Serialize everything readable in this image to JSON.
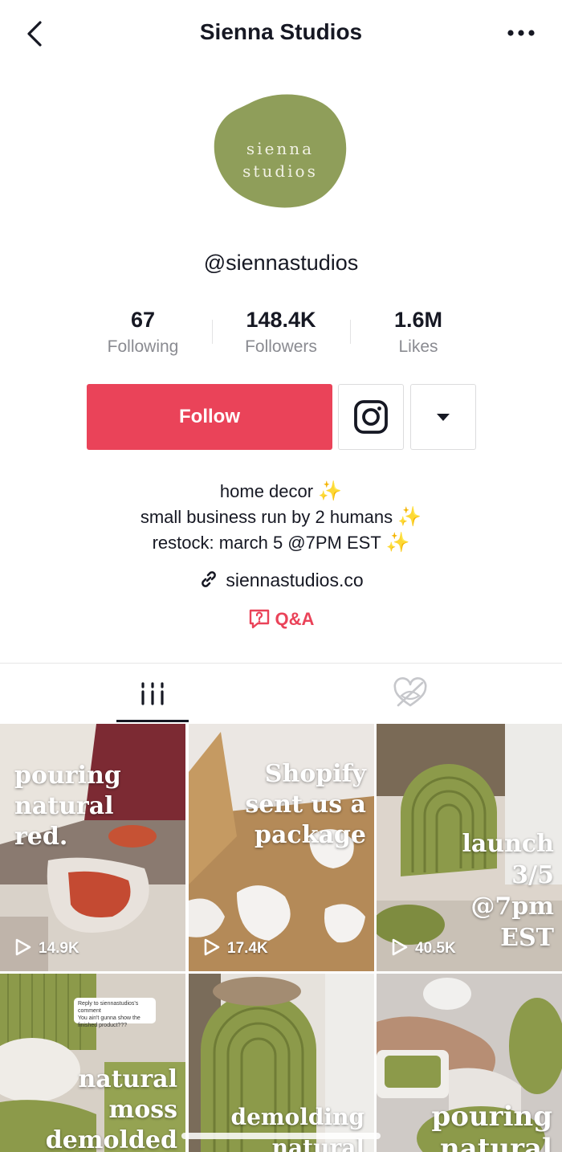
{
  "header": {
    "title": "Sienna Studios"
  },
  "profile": {
    "avatar_lines": [
      "sienna",
      "studios"
    ],
    "handle": "@siennastudios",
    "stats": [
      {
        "value": "67",
        "label": "Following"
      },
      {
        "value": "148.4K",
        "label": "Followers"
      },
      {
        "value": "1.6M",
        "label": "Likes"
      }
    ],
    "follow_label": "Follow",
    "bio": [
      "home decor",
      "small business run by 2 humans",
      "restock: march 5 @7PM EST"
    ],
    "bio_emoji": "✨",
    "link": "siennastudios.co",
    "qa_label": "Q&A"
  },
  "colors": {
    "accent": "#ea4359",
    "avatar_green": "#8f9e5a",
    "text": "#161823",
    "muted": "#8a8b91"
  },
  "icons": {
    "back": "chevron-left-icon",
    "more": "more-horizontal-icon",
    "instagram": "instagram-icon",
    "dropdown": "caret-down-icon",
    "link": "link-icon",
    "qa": "question-bubble-icon",
    "videos_tab": "grid-icon",
    "liked_tab": "liked-hidden-icon",
    "play": "play-icon"
  },
  "videos": [
    {
      "caption": [
        "pouring",
        "natural",
        "red."
      ],
      "views": "14.9K"
    },
    {
      "caption": [
        "Shopify",
        "sent us a",
        "package"
      ],
      "views": "17.4K"
    },
    {
      "caption": [
        "launch",
        "3/5",
        "@7pm",
        "EST"
      ],
      "views": "40.5K"
    },
    {
      "caption": [
        "natural",
        "moss",
        "demolded"
      ],
      "views": "",
      "comment_lines": [
        "Reply to siennastudios's comment",
        "You ain't gunna show the",
        "finished product???"
      ]
    },
    {
      "caption": [
        "demolding",
        "natural"
      ],
      "views": ""
    },
    {
      "caption": [
        "pouring",
        "natural"
      ],
      "views": ""
    }
  ]
}
